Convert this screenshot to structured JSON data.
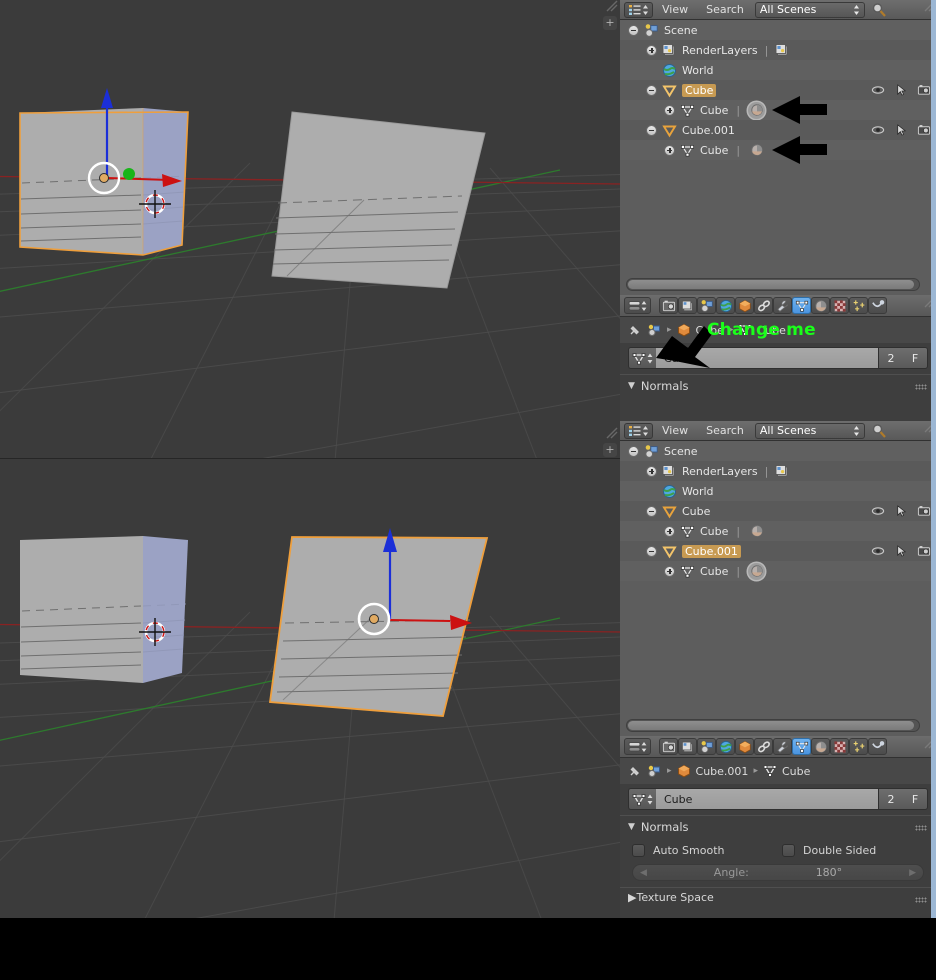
{
  "app": {
    "name": "Blender",
    "window_title": "Blender"
  },
  "viewport": {
    "name": "3d-viewport",
    "background": "#3b3b3b",
    "grid_color": "#4a4a4a",
    "axis_x_color": "#8c2f2f",
    "axis_y_color": "#2f8c2f",
    "objects_top": [
      {
        "name": "Cube",
        "type": "cube",
        "selected": true,
        "outline_color": "#ef9f3c"
      },
      {
        "name": "Cube.001",
        "type": "plane",
        "selected": false
      }
    ],
    "objects_bottom": [
      {
        "name": "Cube",
        "type": "cube",
        "selected": false
      },
      {
        "name": "Cube.001",
        "type": "plane",
        "selected": true,
        "outline_color": "#ef9f3c"
      }
    ],
    "manipulator": {
      "x_axis_color": "#d01010",
      "y_axis_color": "#10c010",
      "z_axis_color": "#1030e0"
    },
    "cursor_3d": "3d-cursor"
  },
  "outliner_top": {
    "header": {
      "editor_type": "outliner-editor-icon",
      "menus": [
        "View",
        "Search"
      ],
      "display_mode": "All Scenes",
      "search_icon": "magnifier-icon"
    },
    "rows": [
      {
        "indent": 0,
        "expander": "minus",
        "icon": "scene-icon",
        "label": "Scene",
        "highlight": false,
        "kind": "scene"
      },
      {
        "indent": 1,
        "expander": "plus",
        "icon": "renderlayers-icon",
        "label": "RenderLayers",
        "highlight": false,
        "kind": "renderlayers",
        "extra_icon": "renderlayers-icon"
      },
      {
        "indent": 1,
        "expander": "none",
        "icon": "world-icon",
        "label": "World",
        "highlight": false,
        "kind": "world"
      },
      {
        "indent": 1,
        "expander": "minus",
        "icon": "object-mesh-icon",
        "label": "Cube",
        "highlight": true,
        "kind": "object",
        "restrict": [
          "eye-icon",
          "cursor-arrow-icon",
          "camera-icon"
        ]
      },
      {
        "indent": 2,
        "expander": "plus",
        "icon": "mesh-data-icon",
        "label": "Cube",
        "highlight": false,
        "kind": "meshdata",
        "data_icon": "material-sphere-icon",
        "arrow": true,
        "data_icon_active": true
      },
      {
        "indent": 1,
        "expander": "minus",
        "icon": "object-mesh-icon",
        "label": "Cube.001",
        "highlight": false,
        "kind": "object",
        "restrict": [
          "eye-icon",
          "cursor-arrow-icon",
          "camera-icon"
        ]
      },
      {
        "indent": 2,
        "expander": "plus",
        "icon": "mesh-data-icon",
        "label": "Cube",
        "highlight": false,
        "kind": "meshdata",
        "data_icon": "material-sphere-icon",
        "arrow": true,
        "data_icon_active": false
      }
    ],
    "scrollbar": "horizontal-scrollbar"
  },
  "properties_top": {
    "tabs": [
      {
        "name": "render-tab",
        "icon": "camera-back-icon",
        "active": false
      },
      {
        "name": "render-layers-tab",
        "icon": "render-layers-icon",
        "active": false
      },
      {
        "name": "scene-tab",
        "icon": "scene-icon",
        "active": false
      },
      {
        "name": "world-tab",
        "icon": "world-icon",
        "active": false
      },
      {
        "name": "object-tab",
        "icon": "object-cube-icon",
        "active": false
      },
      {
        "name": "constraints-tab",
        "icon": "chain-icon",
        "active": false
      },
      {
        "name": "modifiers-tab",
        "icon": "wrench-icon",
        "active": false
      },
      {
        "name": "object-data-tab",
        "icon": "mesh-data-icon",
        "active": true
      },
      {
        "name": "material-tab",
        "icon": "material-sphere-icon",
        "active": false
      },
      {
        "name": "texture-tab",
        "icon": "checker-texture-icon",
        "active": false
      },
      {
        "name": "particles-tab",
        "icon": "particles-icon",
        "active": false
      },
      {
        "name": "physics-tab",
        "icon": "physics-icon",
        "active": false
      }
    ],
    "breadcrumb": {
      "pin_icon": "pin-icon",
      "scene_icon": "scene-icon",
      "items": [
        {
          "icon": "object-cube-icon",
          "label": "Cube"
        },
        {
          "icon": "mesh-data-icon",
          "label": "Cube"
        }
      ]
    },
    "datablock": {
      "icon": "mesh-data-icon",
      "value": "Cube",
      "users_count": "2",
      "fake_user_label": "F"
    },
    "panels": [
      {
        "title": "Normals",
        "open": true
      }
    ]
  },
  "outliner_bottom": {
    "header": {
      "editor_type": "outliner-editor-icon",
      "menus": [
        "View",
        "Search"
      ],
      "display_mode": "All Scenes",
      "search_icon": "magnifier-icon"
    },
    "rows": [
      {
        "indent": 0,
        "expander": "minus",
        "icon": "scene-icon",
        "label": "Scene",
        "highlight": false,
        "kind": "scene"
      },
      {
        "indent": 1,
        "expander": "plus",
        "icon": "renderlayers-icon",
        "label": "RenderLayers",
        "highlight": false,
        "kind": "renderlayers",
        "extra_icon": "renderlayers-icon"
      },
      {
        "indent": 1,
        "expander": "none",
        "icon": "world-icon",
        "label": "World",
        "highlight": false,
        "kind": "world"
      },
      {
        "indent": 1,
        "expander": "minus",
        "icon": "object-mesh-icon",
        "label": "Cube",
        "highlight": false,
        "kind": "object",
        "restrict": [
          "eye-icon",
          "cursor-arrow-icon",
          "camera-icon"
        ]
      },
      {
        "indent": 2,
        "expander": "plus",
        "icon": "mesh-data-icon",
        "label": "Cube",
        "highlight": false,
        "kind": "meshdata",
        "data_icon": "material-sphere-icon",
        "arrow": false,
        "data_icon_active": false
      },
      {
        "indent": 1,
        "expander": "minus",
        "icon": "object-mesh-icon",
        "label": "Cube.001",
        "highlight": true,
        "kind": "object",
        "restrict": [
          "eye-icon",
          "cursor-arrow-icon",
          "camera-icon"
        ]
      },
      {
        "indent": 2,
        "expander": "plus",
        "icon": "mesh-data-icon",
        "label": "Cube",
        "highlight": false,
        "kind": "meshdata",
        "data_icon": "material-sphere-icon",
        "arrow": false,
        "data_icon_active": true
      }
    ],
    "scrollbar": "horizontal-scrollbar"
  },
  "properties_bottom": {
    "tabs": [
      {
        "name": "render-tab",
        "icon": "camera-back-icon",
        "active": false
      },
      {
        "name": "render-layers-tab",
        "icon": "render-layers-icon",
        "active": false
      },
      {
        "name": "scene-tab",
        "icon": "scene-icon",
        "active": false
      },
      {
        "name": "world-tab",
        "icon": "world-icon",
        "active": false
      },
      {
        "name": "object-tab",
        "icon": "object-cube-icon",
        "active": false
      },
      {
        "name": "constraints-tab",
        "icon": "chain-icon",
        "active": false
      },
      {
        "name": "modifiers-tab",
        "icon": "wrench-icon",
        "active": false
      },
      {
        "name": "object-data-tab",
        "icon": "mesh-data-icon",
        "active": true
      },
      {
        "name": "material-tab",
        "icon": "material-sphere-icon",
        "active": false
      },
      {
        "name": "texture-tab",
        "icon": "checker-texture-icon",
        "active": false
      },
      {
        "name": "particles-tab",
        "icon": "particles-icon",
        "active": false
      },
      {
        "name": "physics-tab",
        "icon": "physics-icon",
        "active": false
      }
    ],
    "breadcrumb": {
      "pin_icon": "pin-icon",
      "scene_icon": "scene-icon",
      "items": [
        {
          "icon": "object-cube-icon",
          "label": "Cube.001"
        },
        {
          "icon": "mesh-data-icon",
          "label": "Cube"
        }
      ]
    },
    "datablock": {
      "icon": "mesh-data-icon",
      "value": "Cube",
      "users_count": "2",
      "fake_user_label": "F"
    },
    "panels": [
      {
        "title": "Normals",
        "open": true
      },
      {
        "title": "Texture Space",
        "open": false
      }
    ],
    "normals": {
      "auto_smooth_label": "Auto Smooth",
      "auto_smooth_checked": false,
      "double_sided_label": "Double Sided",
      "double_sided_checked": false,
      "angle_label": "Angle:",
      "angle_value": "180°"
    }
  },
  "annotations": {
    "text": "Change me",
    "text_color": "#1aff1a",
    "arrows": [
      {
        "name": "arrow-outliner-mesh-1",
        "points_to": "mesh-data-icon-row-5"
      },
      {
        "name": "arrow-outliner-mesh-2",
        "points_to": "mesh-data-icon-row-7"
      },
      {
        "name": "arrow-breadcrumb",
        "points_to": "properties-breadcrumb-scene-icon"
      }
    ]
  }
}
